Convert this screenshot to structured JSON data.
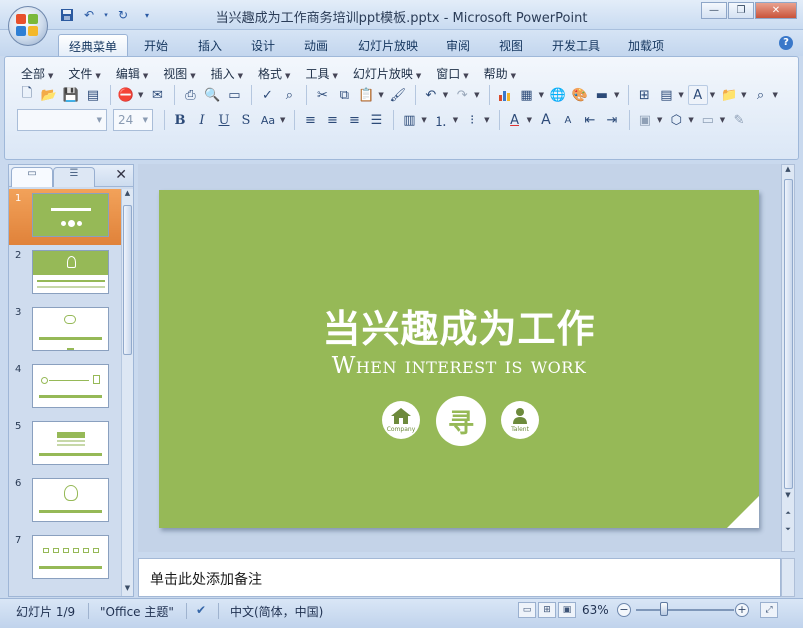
{
  "window": {
    "title": "当兴趣成为工作商务培训ppt模板.pptx - Microsoft PowerPoint"
  },
  "quick_access": {
    "icons": [
      "save-icon",
      "undo-icon",
      "redo-icon"
    ]
  },
  "ribbon_tabs": [
    "经典菜单",
    "开始",
    "插入",
    "设计",
    "动画",
    "幻灯片放映",
    "审阅",
    "视图",
    "开发工具",
    "加载项"
  ],
  "active_tab": "经典菜单",
  "menus": [
    "全部",
    "文件",
    "编辑",
    "视图",
    "插入",
    "格式",
    "工具",
    "幻灯片放映",
    "窗口",
    "帮助"
  ],
  "format_bar": {
    "font_name": "",
    "font_size": "24"
  },
  "thumbnails": [
    {
      "number": "1"
    },
    {
      "number": "2"
    },
    {
      "number": "3"
    },
    {
      "number": "4"
    },
    {
      "number": "5"
    },
    {
      "number": "6"
    },
    {
      "number": "7"
    }
  ],
  "selected_slide": "1",
  "slide": {
    "title": "当兴趣成为工作",
    "subtitle": "When interest is work",
    "icons": [
      {
        "name": "home-icon",
        "label": "Company"
      },
      {
        "name": "search-seal-icon",
        "label": "寻"
      },
      {
        "name": "person-icon",
        "label": "Talent"
      }
    ],
    "background_color": "#96b957"
  },
  "notes": {
    "placeholder": "单击此处添加备注"
  },
  "status": {
    "slide_info": "幻灯片 1/9",
    "theme": "\"Office 主题\"",
    "language": "中文(简体，中国)",
    "zoom": "63%"
  }
}
